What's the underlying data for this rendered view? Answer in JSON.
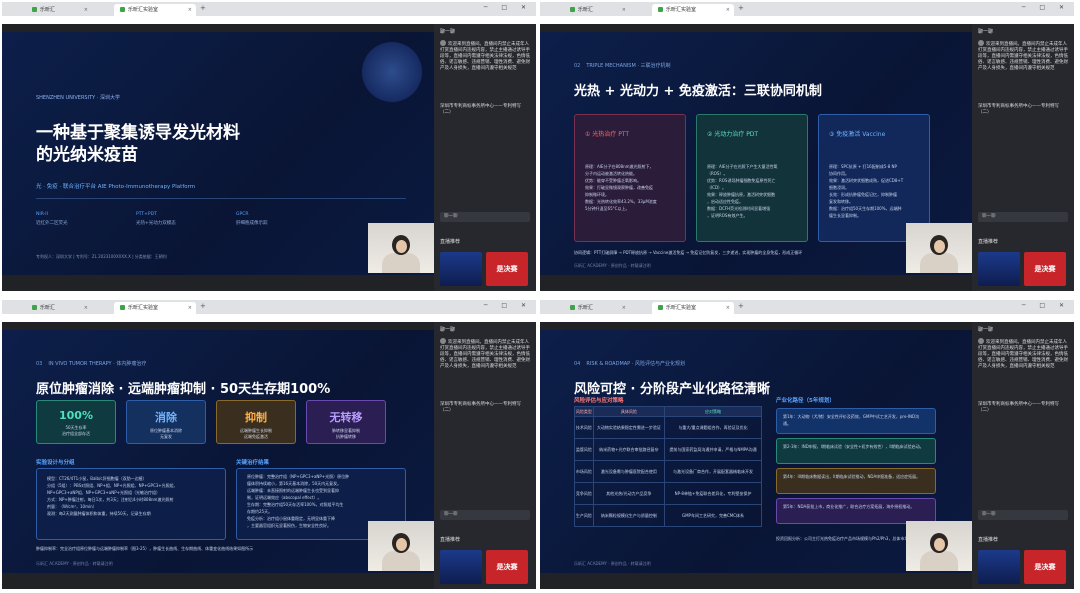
{
  "browser": {
    "tab1_label": "乐昕汇",
    "tab2_label": "乐昕汇实验室",
    "new_tab": "+",
    "window_controls": "─ □ ✕"
  },
  "chat": {
    "title": "聊一聊",
    "msg1": "欢迎来到直播间。直播间内禁止未成年人打赏直播间内违规内容，禁止主播通过诱导手段等，直播间内需遵守相关法律法规，色情低俗、谣言敏感、违规营销、理性消费、避免财产及人身损失，直播间内遵守相关规范",
    "msg2": "深圳市专利商标事务所中心——专利特写（二）",
    "input": "聊一聊",
    "rec": "直播推荐",
    "ad_text": "是决赛"
  },
  "s1": {
    "uni": "SHENZHEN UNIVERSITY · 深圳大学",
    "title_line1": "一种基于聚集诱导发光材料",
    "title_line2": "的光纳米疫苗",
    "subtitle": "光 · 免疫 · 联合治疗平台   AIE Photo-Immunotherapy Platform",
    "kw1_head": "NIR-II",
    "kw1_text": "近红外二区荧光",
    "kw2_head": "PTT+PDT",
    "kw2_text": "光热+光动力双模态",
    "kw3_head": "GPCR",
    "kw3_text": "肝细胞成像示踪",
    "info": "专利权人：深圳大学  |  专利号：ZL 2023100XXXX.X  |  分类依据：王朝利"
  },
  "s2": {
    "num": "02",
    "hdr": "TRIPLE MECHANISM · 三联治疗机制",
    "title": "光热 + 光动力 + 免疫激活：三联协同机制",
    "c1_title": "① 光热治疗 PTT",
    "c1_lines": [
      "原理：AIE分子在808nm激光照射下，",
      "分子内运动被激活转化热能。",
      "优势：能穿不受肿瘤乏氧影响。",
      "效果：打破显微镜观察肿瘤，改善免疫",
      "抑制微环境。",
      "数据：光热转化效率43.2%，33μM浓度",
      "5分钟升温至65°C以上。"
    ],
    "c2_title": "② 光动力治疗 PDT",
    "c2_lines": [
      "原理：AIE分子在光照下产生大量活性氧",
      "（ROS）。",
      "优势：ROS诱导肿瘤细胞免疫原性死亡",
      "（ICD）。",
      "效果：释放肿瘤抗原，激活树突状细胞",
      "，启动适应性免疫。",
      "数据：DCFH荧光检测时间显著增强",
      "，证明ROS有效产生。"
    ],
    "c3_title": "③ 免疫激活 Vaccine",
    "c3_lines": [
      "原理：SPC抗原 + 打16配制成5-8 NP",
      "协同作用。",
      "效果：激活树突状细胞成熟，促进CD8+T",
      "细胞浸润。",
      "长效：形成抗肿瘤免疫记忆，抑制肿瘤",
      "复发和转移。",
      "数据：治疗组50天生存期100%，远端肿",
      "瘤生长显著抑制。"
    ],
    "summary": "协同逻辑：PTT打破屏障 → PDT释放抗原 → Vaccine激活免疫 → 免疫记忆防复发，三步递进，实现肿瘤的全身免疫，形成正循环"
  },
  "s3": {
    "num": "03",
    "hdr": "IN VIVO TUMOR THERAPY · 体内肿瘤治疗",
    "title": "原位肿瘤消除 · 远端肿瘤抑制 · 50天生存期100%",
    "cards": [
      {
        "v": "100%",
        "d1": "50天生存率",
        "d2": "治疗组全部存活"
      },
      {
        "v": "消除",
        "d1": "原位肿瘤基本消除",
        "d2": "无复发"
      },
      {
        "v": "抑制",
        "d1": "远端肿瘤生长抑制",
        "d2": "远端免疫激活"
      },
      {
        "v": "无转移",
        "d1": "肺转移显著抑制",
        "d2": "抗肿瘤转移"
      }
    ],
    "left_title": "实验设计与分组",
    "left_lines": [
      "模型：CT26/4T1小鼠，Balb/c肝细胞瘤（双肋一边植）",
      "分组（5组）：PBS对照组、NP+组、NP+光照组、NP+GPC3+光照组、",
      "NP+GPC3+aNP组、NP+GPC3+aNP+光照组（光敏治疗组）",
      "方式：NP+肿瘤注射，每日1次，共3天；注射后4小时808nm激光照射",
      "剂量：（W/cm²，10min）",
      "观测：每2天测量肿瘤体积和体重，持续50天，记录生存期"
    ],
    "right_title": "关键治疗结果",
    "right_lines": [
      "原位肿瘤：完整治疗组（NP+GPC3+aNP+光照）原位肿",
      "瘤体积持续缩小，第16天基本消除，50天内无复发。",
      "远端肿瘤：未直接照射的远端肿瘤生长也受到显著抑",
      "制，证明远端效应（abscopal effect）。",
      "生存期：完整治疗组50天存活率100%，对照组平均生",
      "存期约25天。",
      "免疫分析：治疗组小鼠体重稳定，无明显体重下降",
      "，主要器官组织无显著损伤，生物安全性良好。"
    ],
    "summary": "肿瘤抑制率：完全治疗组原位肿瘤与远端肿瘤抑制率（图3-25），肿瘤生长曲线、生存期曲线、体重变化曲线结果如图所示"
  },
  "s4": {
    "num": "04",
    "hdr": "RISK & ROADMAP · 风险评估与产业化规划",
    "title": "风险可控 · 分阶段产业化路径清晰",
    "left_title": "风险评估与应对策略",
    "th": [
      "风险类型",
      "具体风险",
      "应对策略"
    ],
    "rows": [
      [
        "技术风险",
        "大动物实验结果稳定性需进一步验证",
        "与重大/重点课题组合作，再验证及优化"
      ],
      [
        "监管风险",
        "纳米药物+光疗联合审批路径复杂",
        "提前与国家药监局沟通并申请，严格与NMPA沟通"
      ],
      [
        "市场风险",
        "激光设备需与肿瘤医院配合使用",
        "与激光设备厂商合作，开展配套器械临床开发"
      ],
      [
        "竞争风险",
        "其他光热/光动力产品竞争",
        "NP-8单链+免疫联合差异化，专利壁垒保护"
      ],
      [
        "生产风险",
        "纳米颗粒规模化生产与质量控制",
        "GMP车间工艺研究，完善CMC体系"
      ]
    ],
    "right_title": "产业化路径（5年规划）",
    "steps": [
      "第1年：大动物（犬/猪）安全性评价及药效，GMP中试工艺开发，pre-IND沟通。",
      "第2-3年：IND申报，I期临床试验（安全性+初步有效性），II期临床试验启动。",
      "第4年：III期临床数据读出，II期临床试验推动，NDA申报准备，适应症拓展。",
      "第5年：NDA获批上市，商业化推广，联合治疗方案拓展，海外授权推动。"
    ],
    "summary": "投资回报分析：公司主打光热免疫治疗产品市场规模与Ph2/Ph3，总体市场空间广阔"
  },
  "common": {
    "foot": "乐昕汇 ACADEMY · 原创作品 · 转载请注明"
  }
}
